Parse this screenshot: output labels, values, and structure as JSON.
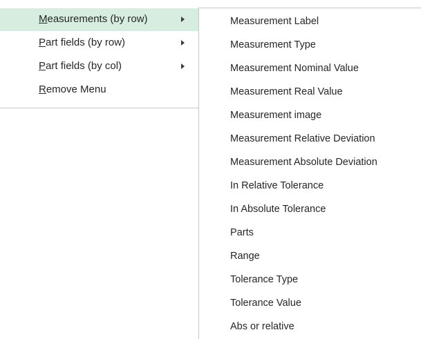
{
  "main_menu": {
    "items": [
      {
        "accel": "M",
        "rest": "easurements (by row)",
        "has_submenu": true,
        "active": true
      },
      {
        "accel": "P",
        "rest": "art fields (by row)",
        "has_submenu": true,
        "active": false
      },
      {
        "accel": "P",
        "rest": "art fields (by col)",
        "has_submenu": true,
        "active": false
      },
      {
        "accel": "R",
        "rest": "emove Menu",
        "has_submenu": false,
        "active": false
      }
    ],
    "active_color": "#d7ede0"
  },
  "submenu": {
    "items": [
      "Measurement Label",
      "Measurement Type",
      "Measurement Nominal Value",
      "Measurement Real Value",
      "Measurement image",
      "Measurement Relative Deviation",
      "Measurement Absolute Deviation",
      "In Relative Tolerance",
      "In Absolute Tolerance",
      "Parts",
      "Range",
      "Tolerance Type",
      "Tolerance Value",
      "Abs or relative"
    ]
  }
}
